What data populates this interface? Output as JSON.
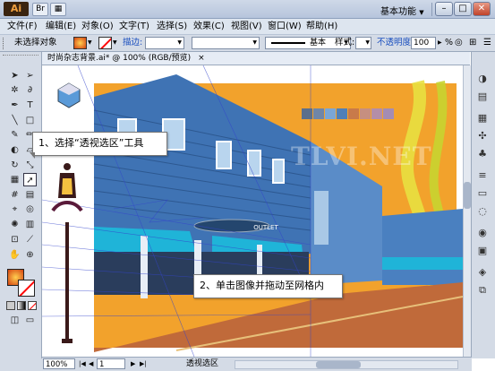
{
  "app": {
    "logo": "Ai",
    "workspace": "基本功能",
    "workspace_arrow": "▼"
  },
  "menu": [
    "文件(F)",
    "编辑(E)",
    "对象(O)",
    "文字(T)",
    "选择(S)",
    "效果(C)",
    "视图(V)",
    "窗口(W)",
    "帮助(H)"
  ],
  "control": {
    "selection_label": "未选择对象",
    "stroke_label": "描边:",
    "stroke_style": "基本",
    "style_label": "样式:",
    "opacity_label": "不透明度:",
    "opacity_value": "100",
    "percent": "%"
  },
  "document": {
    "tab": "时尚杂志背景.ai* @ 100% (RGB/预览)",
    "close": "×"
  },
  "watermark": "TLVI.NET",
  "sign_text": "OUTLET",
  "callouts": {
    "step1": "1、选择“透视选区”工具",
    "step2": "2、单击图像并拖动至网格内"
  },
  "status": {
    "zoom": "100%",
    "page": "1",
    "tool": "透视选区"
  },
  "swatches": [
    "#5b6f8c",
    "#6f86a8",
    "#7aa6d6",
    "#4f7fb8",
    "#c87a4a",
    "#c68f80",
    "#b48ea8",
    "#a48cb4"
  ],
  "colors": {
    "sky": "#f2a22c",
    "building": "#3f73b4",
    "awning": "#1fb4d8",
    "road": "#c06a3a",
    "accent": "#e8e040"
  }
}
